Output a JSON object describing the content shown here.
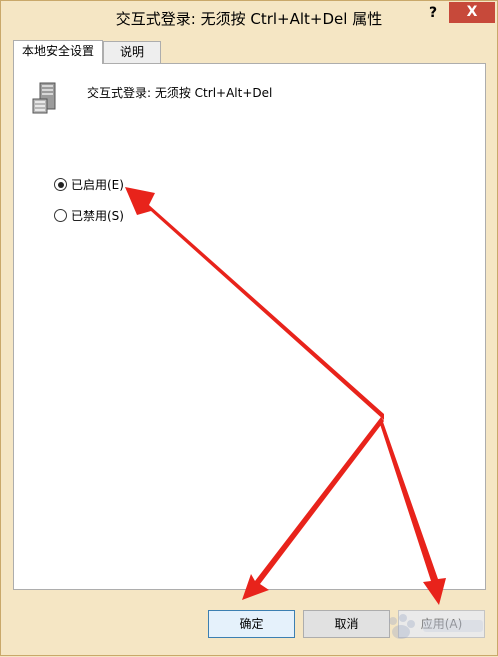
{
  "window": {
    "title": "交互式登录: 无须按 Ctrl+Alt+Del 属性",
    "help_label": "?",
    "close_label": "X"
  },
  "tabs": [
    {
      "label": "本地安全设置",
      "active": true
    },
    {
      "label": "说明",
      "active": false
    }
  ],
  "policy": {
    "icon": "server-icon",
    "name": "交互式登录: 无须按 Ctrl+Alt+Del"
  },
  "options": [
    {
      "label": "已启用(E)",
      "checked": true
    },
    {
      "label": "已禁用(S)",
      "checked": false
    }
  ],
  "buttons": {
    "ok": "确定",
    "cancel": "取消",
    "apply": "应用(A)"
  },
  "colors": {
    "frame": "#f5e6c4",
    "close": "#c7493a",
    "arrow": "#e8231b"
  }
}
